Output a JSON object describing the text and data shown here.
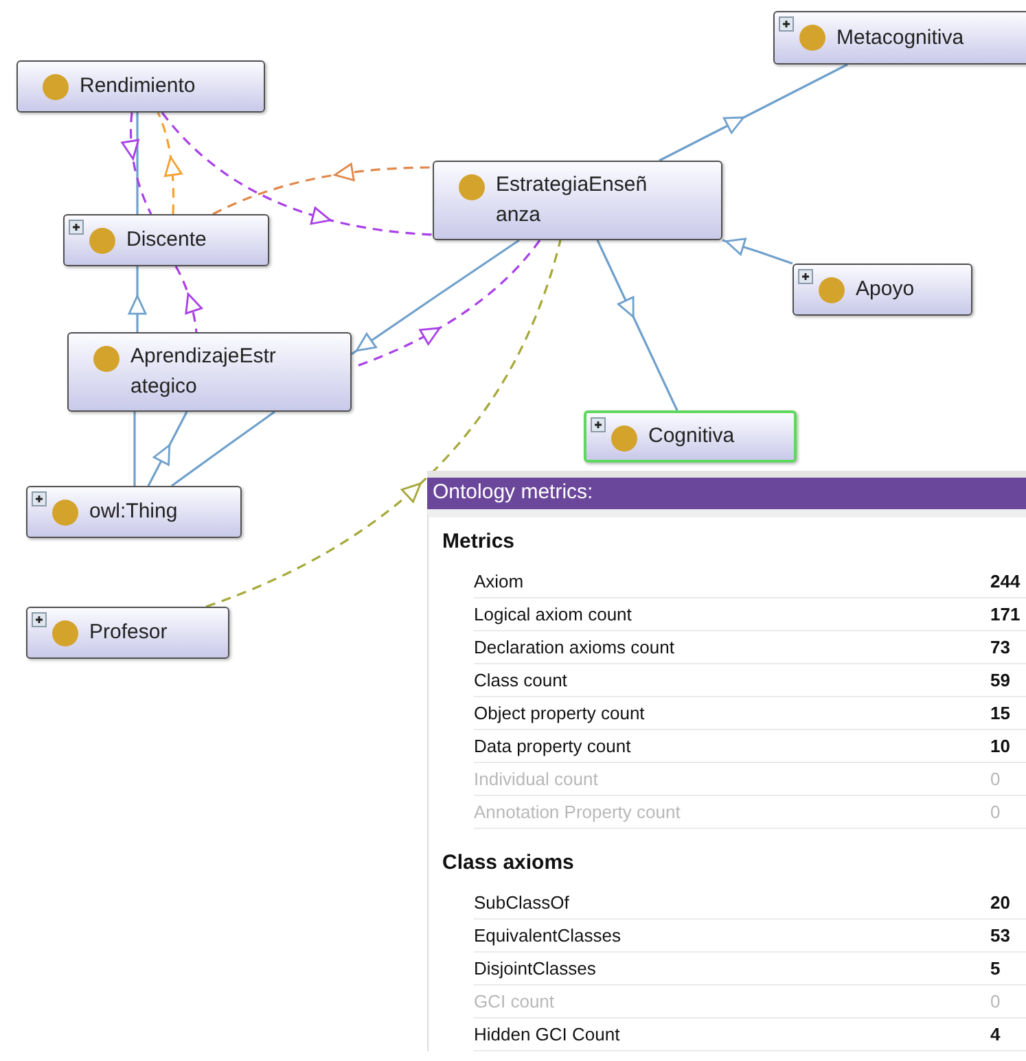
{
  "graph": {
    "nodes": [
      {
        "label": "Metacognitiva",
        "expandable": true,
        "selected": false
      },
      {
        "label": "Rendimiento",
        "expandable": false,
        "selected": false
      },
      {
        "label": "EstrategiaEnseñ\nanza",
        "expandable": false,
        "selected": false
      },
      {
        "label": "Discente",
        "expandable": true,
        "selected": false
      },
      {
        "label": "Apoyo",
        "expandable": true,
        "selected": false
      },
      {
        "label": "AprendizajeEstr\nategico",
        "expandable": false,
        "selected": false
      },
      {
        "label": "Cognitiva",
        "expandable": true,
        "selected": true
      },
      {
        "label": "owl:Thing",
        "expandable": true,
        "selected": false
      },
      {
        "label": "Profesor",
        "expandable": true,
        "selected": false
      }
    ]
  },
  "metrics_panel": {
    "title": "Ontology metrics:",
    "sections": [
      {
        "heading": "Metrics",
        "rows": [
          {
            "label": "Axiom",
            "value": "244",
            "disabled": false
          },
          {
            "label": "Logical axiom count",
            "value": "171",
            "disabled": false
          },
          {
            "label": "Declaration axioms count",
            "value": "73",
            "disabled": false
          },
          {
            "label": "Class count",
            "value": "59",
            "disabled": false
          },
          {
            "label": "Object property count",
            "value": "15",
            "disabled": false
          },
          {
            "label": "Data property count",
            "value": "10",
            "disabled": false
          },
          {
            "label": "Individual count",
            "value": "0",
            "disabled": true
          },
          {
            "label": "Annotation Property count",
            "value": "0",
            "disabled": true
          }
        ]
      },
      {
        "heading": "Class axioms",
        "rows": [
          {
            "label": "SubClassOf",
            "value": "20",
            "disabled": false
          },
          {
            "label": "EquivalentClasses",
            "value": "53",
            "disabled": false
          },
          {
            "label": "DisjointClasses",
            "value": "5",
            "disabled": false
          },
          {
            "label": "GCI count",
            "value": "0",
            "disabled": true
          },
          {
            "label": "Hidden GCI Count",
            "value": "4",
            "disabled": false
          }
        ]
      }
    ]
  }
}
